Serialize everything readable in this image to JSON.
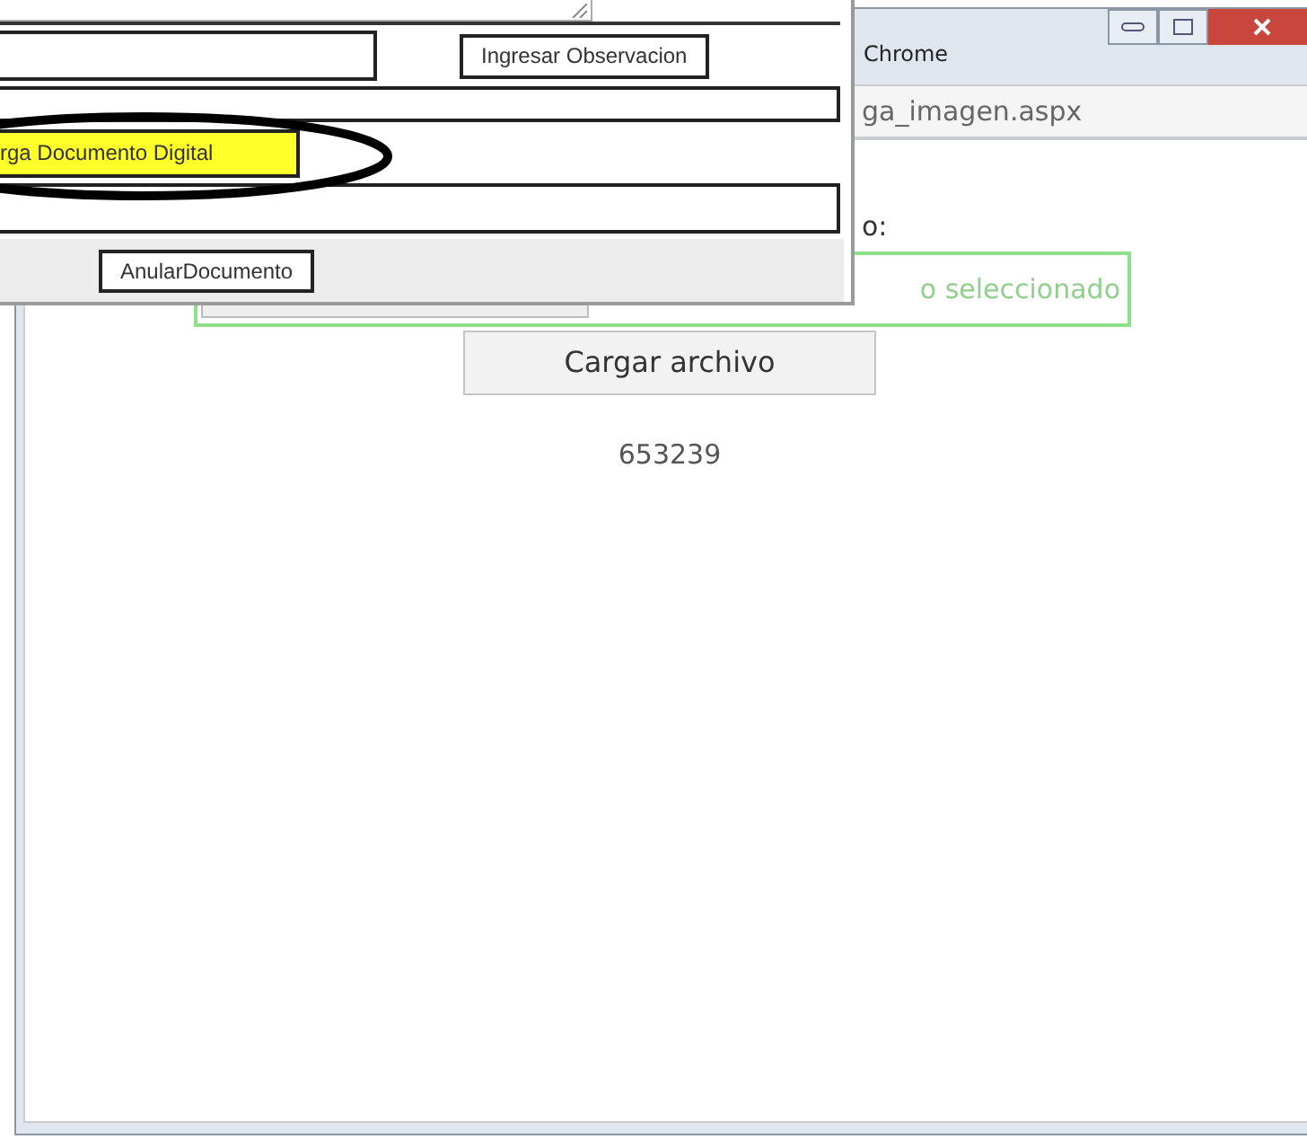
{
  "browser_window": {
    "title": "Chrome",
    "address": "ga_imagen.aspx",
    "label": "o:",
    "file_input": {
      "status": "o seleccionado"
    },
    "upload_button": "Cargar archivo",
    "result": "653239"
  },
  "form_panel": {
    "observation_button": "Ingresar Observacion",
    "upload_document_button": "rga Documento Digital",
    "cancel_button": "AnularDocumento"
  }
}
